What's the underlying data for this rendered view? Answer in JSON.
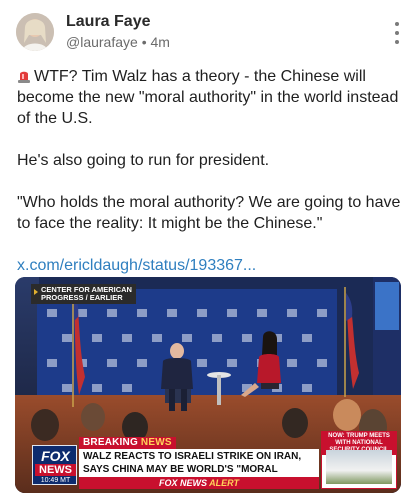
{
  "author": {
    "name": "Laura Faye",
    "handle": "@laurafaye",
    "separator": "•",
    "time": "4m"
  },
  "post": {
    "line1": "WTF? Tim Walz has a theory - the Chinese will become the new \"moral authority\" in the world instead of the U.S.",
    "line2": "He's also going to run for president.",
    "line3": "\"Who holds the moral authority? We are going to have to face the reality: It might be the Chinese.\"",
    "link": "x.com/ericldaugh/status/193367..."
  },
  "video": {
    "top_tag_line1": "CENTER FOR AMERICAN",
    "top_tag_line2": "PROGRESS / EARLIER",
    "breaking_1": "BREAKING",
    "breaking_2": "NEWS",
    "headline_line1": "WALZ REACTS TO ISRAELI STRIKE ON IRAN,",
    "headline_line2": "SAYS CHINA MAY BE WORLD'S \"MORAL AUTHORITY\"",
    "alert_fox": "FOX NEWS",
    "alert_word": "ALERT",
    "fox_word": "FOX",
    "news_word": "NEWS",
    "clock": "10:49 MT",
    "side_box_title": "NOW: TRUMP MEETS WITH NATIONAL SECURITY COUNCIL"
  },
  "icons": {
    "siren": "siren-icon",
    "more": "more-vertical-icon"
  },
  "colors": {
    "link": "#2f7fbf",
    "fox_red": "#c8102e",
    "fox_blue": "#0d2b6e"
  }
}
